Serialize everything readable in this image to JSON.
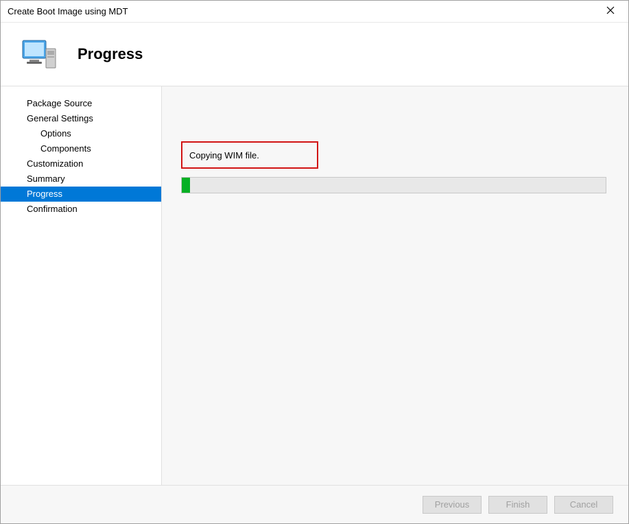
{
  "window": {
    "title": "Create Boot Image using MDT"
  },
  "header": {
    "title": "Progress"
  },
  "sidebar": {
    "items": [
      {
        "label": "Package Source",
        "level": 0,
        "active": false
      },
      {
        "label": "General Settings",
        "level": 0,
        "active": false
      },
      {
        "label": "Options",
        "level": 1,
        "active": false
      },
      {
        "label": "Components",
        "level": 1,
        "active": false
      },
      {
        "label": "Customization",
        "level": 0,
        "active": false
      },
      {
        "label": "Summary",
        "level": 0,
        "active": false
      },
      {
        "label": "Progress",
        "level": 0,
        "active": true
      },
      {
        "label": "Confirmation",
        "level": 0,
        "active": false
      }
    ]
  },
  "content": {
    "status_text": "Copying WIM file.",
    "progress_percent": 2
  },
  "footer": {
    "previous_label": "Previous",
    "finish_label": "Finish",
    "cancel_label": "Cancel"
  }
}
